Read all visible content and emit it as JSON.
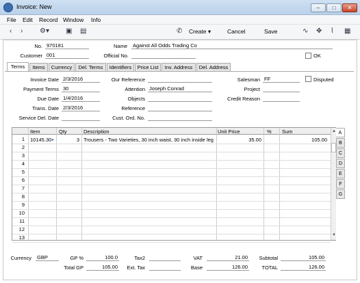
{
  "window": {
    "title": "Invoice: New"
  },
  "menu": [
    "File",
    "Edit",
    "Record",
    "Window",
    "Info"
  ],
  "toolbar": {
    "create": "Create",
    "cancel": "Cancel",
    "save": "Save"
  },
  "header": {
    "no_label": "No.",
    "no_value": "970181",
    "name_label": "Name",
    "name_value": "Against All Odds Trading Co",
    "customer_label": "Customer",
    "customer_value": "001",
    "official_label": "Official No.",
    "official_value": "",
    "ok_label": "OK"
  },
  "tabs": [
    "Terms",
    "Items",
    "Currency",
    "Del. Terms",
    "Identifiers",
    "Price List",
    "Inv. Address",
    "Del. Address"
  ],
  "terms": {
    "invoice_date_label": "Invoice Date",
    "invoice_date": "2/3/2016",
    "payment_terms_label": "Payment Terms",
    "payment_terms": "30",
    "due_date_label": "Due Date",
    "due_date": "1/4/2016",
    "trans_date_label": "Trans. Date",
    "trans_date": "2/3/2016",
    "service_del_label": "Service Del. Date",
    "service_del": "",
    "our_ref_label": "Our Reference",
    "our_ref": "",
    "attention_label": "Attention",
    "attention": "Joseph Conrad",
    "objects_label": "Objects",
    "objects": "",
    "reference_label": "Reference",
    "reference": "",
    "cust_ord_label": "Cust. Ord. No.",
    "cust_ord": "",
    "salesman_label": "Salesman",
    "salesman": "FF",
    "disputed_label": "Disputed",
    "project_label": "Project",
    "project": "",
    "credit_label": "Credit Reason",
    "credit": ""
  },
  "grid": {
    "headers": {
      "item": "Item",
      "qty": "Qty",
      "desc": "Description",
      "price": "Unit Price",
      "pct": "%",
      "sum": "Sum"
    },
    "row1": {
      "num": "1",
      "item": "10145.30",
      "qty": "3",
      "desc": "Trousers - Two Varieties, 30 inch waist, 30 inch inside leg",
      "price": "35.00",
      "sum": "105.00"
    },
    "row_numbers": [
      "1",
      "2",
      "3",
      "4",
      "5",
      "6",
      "7",
      "8",
      "9",
      "10",
      "11",
      "12",
      "13"
    ]
  },
  "side_tabs": [
    "A",
    "B",
    "C",
    "D",
    "E",
    "F",
    "G"
  ],
  "footer": {
    "currency_label": "Currency",
    "currency": "GBP",
    "gp_pct_label": "GP %",
    "gp_pct": "100.0",
    "total_gp_label": "Total GP",
    "total_gp": "105.00",
    "tax2_label": "Tax2",
    "tax2": "",
    "ext_tax_label": "Ext. Tax",
    "ext_tax": "",
    "vat_label": "VAT",
    "vat": "21.00",
    "base_label": "Base",
    "base": "126.00",
    "subtotal_label": "Subtotal",
    "subtotal": "105.00",
    "total_label": "TOTAL",
    "total": "126.00"
  }
}
